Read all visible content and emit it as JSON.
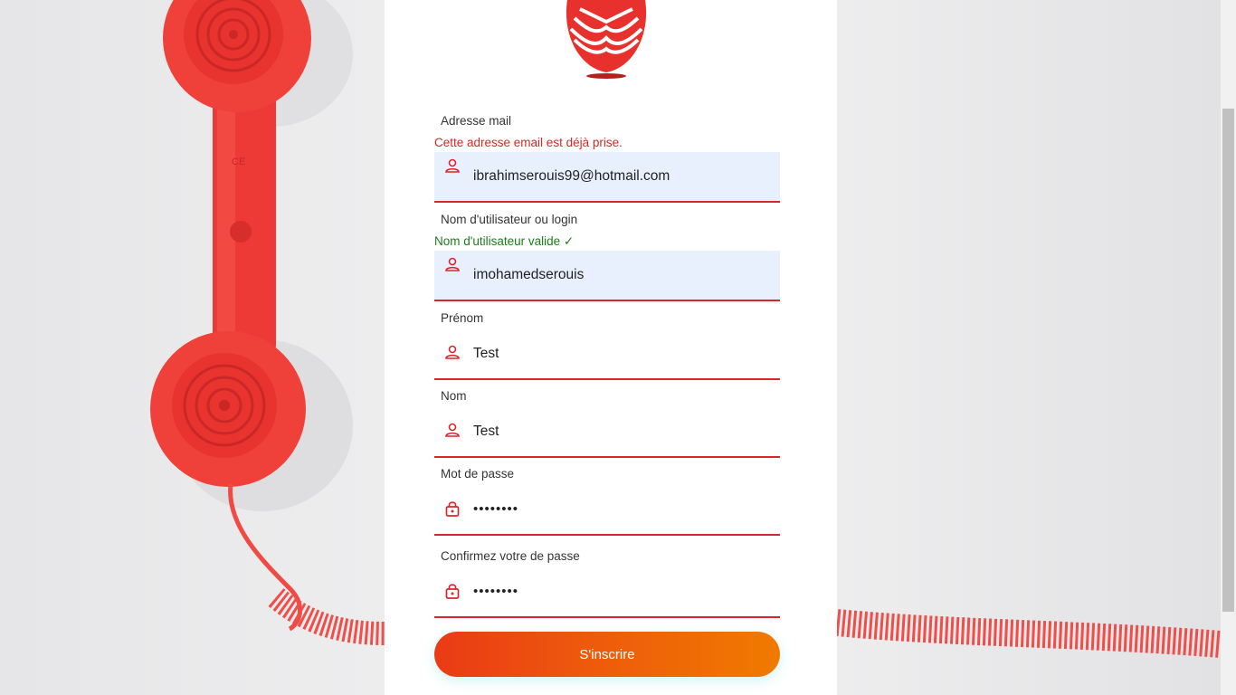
{
  "form": {
    "email": {
      "label": "Adresse mail",
      "error": "Cette adresse email est déjà prise.",
      "value": "ibrahimserouis99@hotmail.com"
    },
    "username": {
      "label": "Nom d'utilisateur ou login",
      "success": "Nom d'utilisateur valide ✓",
      "value": "imohamedserouis"
    },
    "firstname": {
      "label": "Prénom",
      "value": "Test"
    },
    "lastname": {
      "label": "Nom",
      "value": "Test"
    },
    "password": {
      "label": "Mot de passe",
      "value": "••••••••"
    },
    "confirm": {
      "label": "Confirmez votre de passe",
      "value": "••••••••"
    },
    "submit_label": "S'inscrire"
  },
  "colors": {
    "accent": "#d9262c",
    "error": "#e02424",
    "success": "#1f7a1f",
    "autofill": "#e8f0fe",
    "button_start": "#ea3a16",
    "button_end": "#f07a00"
  },
  "icons": {
    "email": "person-icon",
    "username": "person-icon",
    "firstname": "person-icon",
    "lastname": "person-icon",
    "password": "lock-icon",
    "confirm": "lock-icon"
  }
}
